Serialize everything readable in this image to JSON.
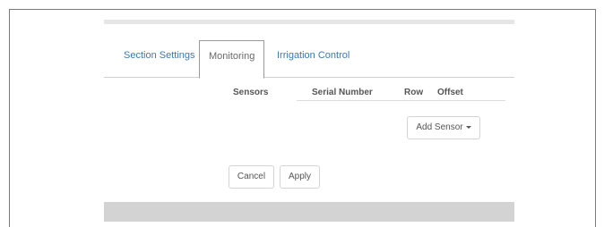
{
  "tabs": [
    {
      "label": "Section Settings"
    },
    {
      "label": "Monitoring"
    },
    {
      "label": "Irrigation Control"
    }
  ],
  "sensors_table": {
    "headers": {
      "sensors": "Sensors",
      "serial_number": "Serial Number",
      "row": "Row",
      "offset": "Offset"
    }
  },
  "buttons": {
    "add_sensor": "Add Sensor",
    "cancel": "Cancel",
    "apply": "Apply"
  },
  "icons": {
    "add_sensor_dropdown": "caret-down-icon"
  },
  "colors": {
    "tab_link": "#3a78b5",
    "panel_footer": "#d3d3d3"
  }
}
